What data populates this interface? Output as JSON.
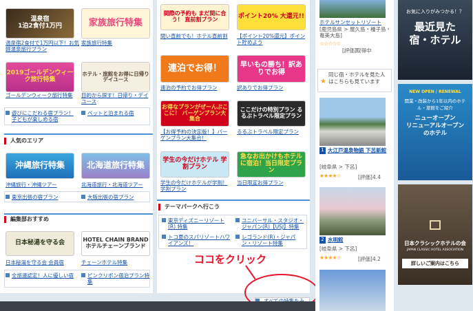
{
  "left_banners": [
    {
      "title": "温泉宿\n1泊2食付1万円",
      "caption": "温泉宿2食付で1万円以下！お気軽温泉旅行プラン"
    },
    {
      "title": "家族旅行特集",
      "caption": "家族旅行特集"
    },
    {
      "title": "2019ゴールデンウィーク旅行特集",
      "caption": "ゴールデンウィーク旅行特集 2019"
    },
    {
      "title": "ホテル・旅館をお得に日帰りデイユース",
      "caption": "目的から探す！日帰り・デイユース"
    }
  ],
  "left_links": [
    "遊びにこだわる宿プラン！子どもが楽しめる宿",
    "ペットと泊まれる宿"
  ],
  "area": {
    "heading": "人気のエリア",
    "banners": [
      {
        "title": "沖縄旅行特集",
        "caption": "沖縄旅行・沖縄ツアー"
      },
      {
        "title": "北海道旅行特集",
        "caption": "北海道旅行・北海道ツアー"
      }
    ],
    "links": [
      "東京出張の宿プラン",
      "大阪出張の宿プラン"
    ]
  },
  "editor": {
    "heading": "編集部おすすめ",
    "banners": [
      {
        "title": "日本秘湯を守る会",
        "caption": "日本秘湯を守る会 会員宿"
      },
      {
        "title": "HOTEL CHAIN BRAND ホテルチェーンブランド",
        "caption": "チェーンホテル特集"
      }
    ],
    "links": [
      "全旅連認定！人に優しい宿",
      "ピンクリボン宿泊プラン特集"
    ]
  },
  "mid_banners": [
    {
      "title": "間際の予約も まだ間に合う！ 直前割プラン",
      "caption": "間い直前でも！ホテル直前割プラン"
    },
    {
      "title": "ポイント20% 大還元!!",
      "caption": "【ポイント20%還元】ポイント貯めよう"
    },
    {
      "title": "連泊でお得！",
      "caption": "連泊の予約でお得プラン"
    },
    {
      "title": "早いもの勝ち！訳ありでお得",
      "caption": "訳ありでお得プラン"
    },
    {
      "title": "お得なプランがぜーんぶここに！ バーゲンプラン大集合",
      "caption": "【お得予約の決定版！】バーゲンプラン大集合！"
    },
    {
      "title": "ここだけの特別プラン るるぶトラベル限定プラン",
      "caption": "るるぶトラベル限定プラン"
    },
    {
      "title": "学生の今だけホテル 学割プラン",
      "caption": "学生の今だけホテルが学割！学割プラン"
    },
    {
      "title": "急なお出かけもホテルに宿泊！当日限定プラン",
      "caption": "当日限定お得プラン"
    }
  ],
  "theme": {
    "heading": "テーマパークへ行こう",
    "links": [
      "東京ディズニーリゾート(R) 特集",
      "ユニバーサル・スタジオ・ジャパン(R)【USJ】特集",
      "トコ夏のスパリゾートハワイアンズ！",
      "レゴランド(R)・ジャパン・リゾート特集"
    ],
    "all_link": "すべての特集をみる"
  },
  "annotation": "ココをクリック",
  "hotels": {
    "top": {
      "name": "ホテルサンセットリゾート",
      "area": "[鹿児島県 > 屋久島・種子島・奄美大島]",
      "rating_label": "[評価]",
      "rating": "取得中"
    },
    "recommend_text": "同じ宿・ホテルを見た人はこちらも見ています",
    "items": [
      {
        "num": "1",
        "name": "大江戸温泉物語 下呂新館",
        "area": "[岐阜県 > 下呂]",
        "rating_label": "[評価]",
        "rating": "4.4"
      },
      {
        "num": "2",
        "name": "水明館",
        "area": "[岐阜県 > 下呂]",
        "rating_label": "[評価]",
        "rating": "4.2"
      }
    ]
  },
  "ads": [
    {
      "top": "お気に入りがみつかる！？",
      "title": "最近見た\n宿・ホテル"
    },
    {
      "top": "NEW OPEN / RENEWAL",
      "sub": "開業・改装から1年以内のホテル・旅館をご紹介",
      "title": "ニューオープン\nリニューアルオープン\nのホテル"
    },
    {
      "title": "日本クラシックホテルの会",
      "sub": "JAPAN CLASSIC HOTEL ASSOCIATION",
      "link": "詳しいご案内はこちら"
    }
  ],
  "colors": {
    "accent": "#d0021b",
    "link": "#1652a8",
    "annotation": "#e8142c"
  }
}
